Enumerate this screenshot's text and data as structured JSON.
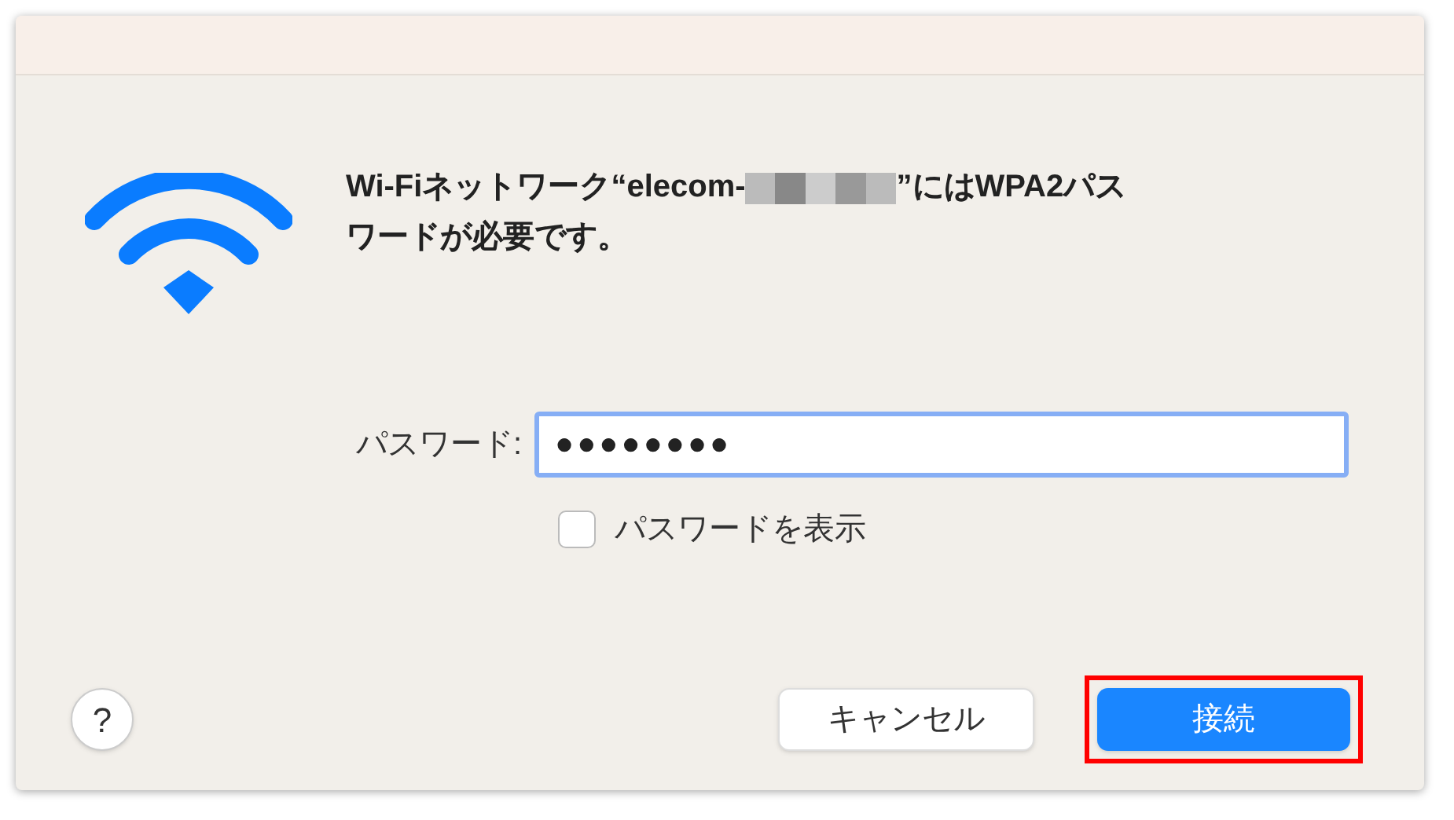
{
  "dialog": {
    "title_parts": [
      "Wi-Fiネットワーク“elecom-",
      "”にはWPA2パス",
      "ワードが必要です。"
    ],
    "network_name_redacted": true
  },
  "password": {
    "label": "パスワード:",
    "value": "●●●●●●●●",
    "focused": true
  },
  "show_password": {
    "label": "パスワードを表示",
    "checked": false
  },
  "help": {
    "label": "?"
  },
  "buttons": [
    {
      "label": "キャンセル",
      "kind": "secondary",
      "highlighted": false
    },
    {
      "label": "接続",
      "kind": "primary",
      "highlighted": true
    }
  ]
}
